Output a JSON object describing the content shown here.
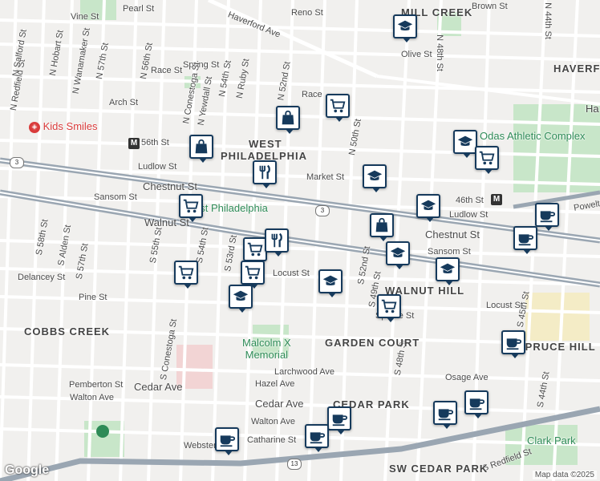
{
  "colors": {
    "marker_border": "#163a5c",
    "park": "#c8e6c9",
    "highway": "#9aa6b2",
    "street": "#ffffff",
    "poi_red": "#d93b3b",
    "poi_green": "#2e8b57"
  },
  "streets": [
    "Vine St",
    "Pearl St",
    "Haverford Ave",
    "Reno St",
    "Brown St",
    "N 44th St",
    "Olive St",
    "N 48th St",
    "N 57th St",
    "N 56th St",
    "N Hobart St",
    "N Wanamaker St",
    "N Redfield St",
    "N Salford St",
    "Race St",
    "Spring St",
    "N 54th St",
    "N Ruby St",
    "N Conestoga St",
    "N Yewdall St",
    "Arch St",
    "N 52nd St",
    "Race",
    "N 50th St",
    "56th St",
    "Ludlow St",
    "Market St",
    "Chestnut St",
    "Sansom St",
    "Walnut St",
    "Locust St",
    "Delancey St",
    "Pine St",
    "S 58th St",
    "S Alden St",
    "S 57th St",
    "S 55th St",
    "S 54th St",
    "S 53rd St",
    "S 52nd St",
    "S 49th St",
    "S 48th St",
    "S 45th St",
    "S 44th St",
    "Spruce St",
    "Osage Ave",
    "Larchwood Ave",
    "Hazel Ave",
    "Cedar Ave",
    "Walton Ave",
    "Pemberton St",
    "Catharine St",
    "S Conestoga St",
    "Webster St",
    "Powelton",
    "46th St",
    "Ludlow St",
    "S Redfield St",
    "Sansom St",
    "Locust St"
  ],
  "neighborhoods": [
    "MILL CREEK",
    "HAVERFORD NORTH",
    "WEST",
    "PHILADELPHIA",
    "COBBS CREEK",
    "GARDEN COURT",
    "WALNUT HILL",
    "SPRUCE HILL",
    "CEDAR PARK",
    "SW CEDAR PARK"
  ],
  "pois": {
    "kids_smiles": "Kids Smiles",
    "athletic": "Odas Athletic Complex",
    "malcolm": "Malcolm X\nMemorial",
    "clark": "Clark Park",
    "west_philly": "West Philadelphia",
    "ha": "Ha"
  },
  "metro": "M",
  "routes": [
    "3",
    "3",
    "13"
  ],
  "footer": {
    "map_data": "Map data ©2025",
    "logo": "Google"
  },
  "markers": [
    {
      "icon": "school",
      "n": 1
    },
    {
      "icon": "bag",
      "n": 2
    },
    {
      "icon": "cart",
      "n": 3
    },
    {
      "icon": "bag",
      "n": 4
    },
    {
      "icon": "school",
      "n": 5
    },
    {
      "icon": "cart",
      "n": 6
    },
    {
      "icon": "school",
      "n": 7
    },
    {
      "icon": "restaurant",
      "n": 8
    },
    {
      "icon": "cart",
      "n": 9
    },
    {
      "icon": "bag",
      "n": 10
    },
    {
      "icon": "school",
      "n": 11
    },
    {
      "icon": "coffee",
      "n": 12
    },
    {
      "icon": "coffee",
      "n": 13
    },
    {
      "icon": "school",
      "n": 14
    },
    {
      "icon": "school",
      "n": 15
    },
    {
      "icon": "cart",
      "n": 16
    },
    {
      "icon": "cart",
      "n": 17
    },
    {
      "icon": "school",
      "n": 18
    },
    {
      "icon": "school",
      "n": 19
    },
    {
      "icon": "cart",
      "n": 20
    },
    {
      "icon": "cart",
      "n": 21
    },
    {
      "icon": "coffee",
      "n": 22
    },
    {
      "icon": "coffee",
      "n": 23
    },
    {
      "icon": "coffee",
      "n": 24
    },
    {
      "icon": "coffee",
      "n": 25
    },
    {
      "icon": "coffee",
      "n": 26
    },
    {
      "icon": "coffee",
      "n": 27
    },
    {
      "icon": "restaurant",
      "n": 28
    }
  ]
}
